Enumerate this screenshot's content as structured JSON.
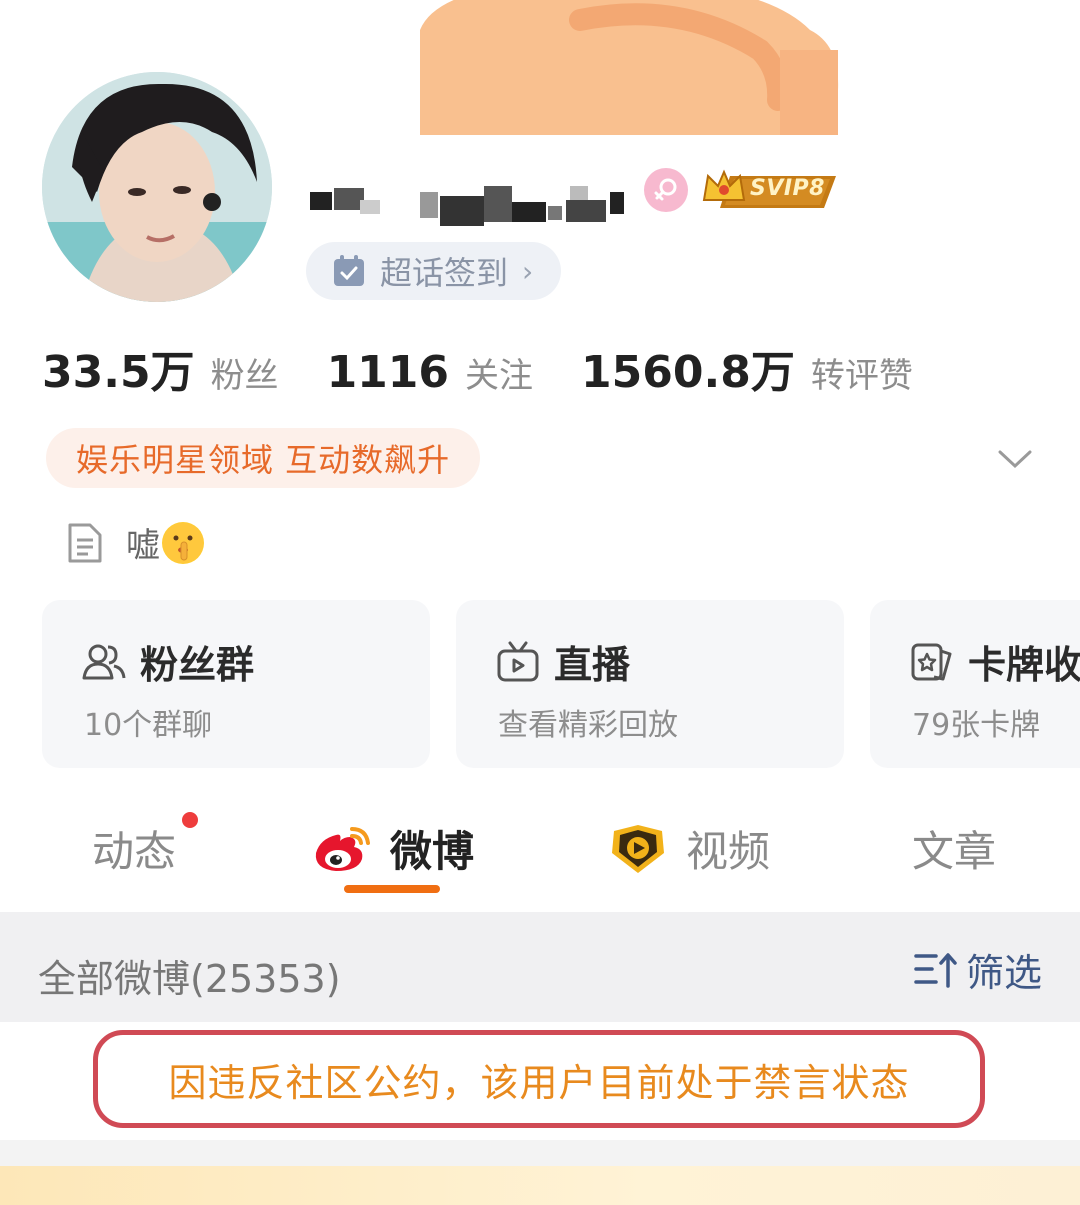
{
  "profile": {
    "verify_sign_label": "超话签到",
    "vip_label": "SVIP8"
  },
  "stats": [
    {
      "value": "33.5万",
      "label": "粉丝"
    },
    {
      "value": "1116",
      "label": "关注"
    },
    {
      "value": "1560.8万",
      "label": "转评赞"
    }
  ],
  "domain_tag": "娱乐明星领域 互动数飙升",
  "bio": "嘘",
  "cards": [
    {
      "title": "粉丝群",
      "subtitle": "10个群聊",
      "icon": "fans-group-icon"
    },
    {
      "title": "直播",
      "subtitle": "查看精彩回放",
      "icon": "live-tv-icon"
    },
    {
      "title": "卡牌收",
      "subtitle": "79张卡牌",
      "icon": "card-collection-icon"
    }
  ],
  "tabs": [
    {
      "label": "动态",
      "has_dot": true
    },
    {
      "label": "微博",
      "active": true,
      "icon": "weibo-icon"
    },
    {
      "label": "视频",
      "icon": "video-icon"
    },
    {
      "label": "文章"
    }
  ],
  "filter": {
    "count_label": "全部微博(25353)",
    "filter_label": "筛选"
  },
  "notice": "因违反社区公约，该用户目前处于禁言状态",
  "colors": {
    "accent_orange": "#f06e12",
    "notice_border": "#d04a55",
    "notice_text": "#e88a1e",
    "tag_text": "#e76a2a",
    "link_blue": "#3f5886"
  }
}
